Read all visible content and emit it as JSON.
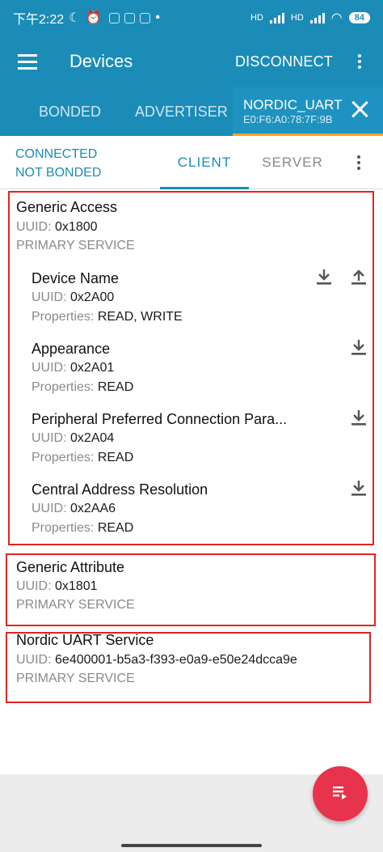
{
  "status_bar": {
    "time": "下午2:22",
    "network_1": "HD",
    "network_2": "HD",
    "battery": "84"
  },
  "app_bar": {
    "title": "Devices",
    "disconnect_label": "DISCONNECT"
  },
  "device_tabs": {
    "bonded": "BONDED",
    "advertiser": "ADVERTISER",
    "device_name": "NORDIC_UART",
    "device_address": "E0:F6:A0:78:7F:9B"
  },
  "connection": {
    "status_connected": "CONNECTED",
    "status_bond": "NOT BONDED",
    "tab_client": "CLIENT",
    "tab_server": "SERVER"
  },
  "labels": {
    "uuid": "UUID:",
    "properties": "Properties:"
  },
  "services": [
    {
      "name": "Generic Access",
      "uuid": "0x1800",
      "type": "PRIMARY SERVICE",
      "characteristics": [
        {
          "name": "Device Name",
          "uuid": "0x2A00",
          "properties": "READ, WRITE",
          "icons": [
            "download-icon",
            "upload-icon"
          ]
        },
        {
          "name": "Appearance",
          "uuid": "0x2A01",
          "properties": "READ",
          "icons": [
            "download-icon"
          ]
        },
        {
          "name": "Peripheral Preferred Connection Para...",
          "uuid": "0x2A04",
          "properties": "READ",
          "icons": [
            "download-icon"
          ]
        },
        {
          "name": "Central Address Resolution",
          "uuid": "0x2AA6",
          "properties": "READ",
          "icons": [
            "download-icon"
          ]
        }
      ]
    },
    {
      "name": "Generic Attribute",
      "uuid": "0x1801",
      "type": "PRIMARY SERVICE"
    },
    {
      "name": "Nordic UART Service",
      "uuid": "6e400001-b5a3-f393-e0a9-e50e24dcca9e",
      "type": "PRIMARY SERVICE"
    }
  ],
  "colors": {
    "primary": "#1b8cb8",
    "tab_indicator": "#f5a623",
    "fab": "#e8334d",
    "highlight_box": "#e02424"
  },
  "fab": {
    "icon": "log-list-icon"
  }
}
